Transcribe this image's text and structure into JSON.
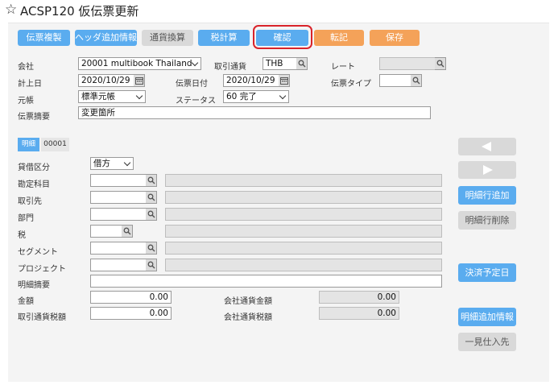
{
  "window": {
    "title": "ACSP120 仮伝票更新"
  },
  "toolbar": {
    "buttons": [
      "伝票複製",
      "ヘッダ追加情報",
      "通貨換算",
      "税計算",
      "確認",
      "転記",
      "保存"
    ]
  },
  "header": {
    "company_label": "会社",
    "company_value": "20001 multibook Thailand",
    "currency_label": "取引通貨",
    "currency_value": "THB",
    "rate_label": "レート",
    "rate_value": "",
    "posting_date_label": "計上日",
    "posting_date_value": "2020/10/29",
    "voucher_date_label": "伝票日付",
    "voucher_date_value": "2020/10/29",
    "voucher_type_label": "伝票タイプ",
    "voucher_type_value": "",
    "ledger_label": "元帳",
    "ledger_value": "標準元帳",
    "status_label": "ステータス",
    "status_value": "60 完了",
    "summary_label": "伝票摘要",
    "summary_value": "変更箇所"
  },
  "detail": {
    "tab_label": "明細",
    "line_number": "00001",
    "dc_label": "貸借区分",
    "dc_value": "借方",
    "account_label": "勘定科目",
    "partner_label": "取引先",
    "department_label": "部門",
    "tax_label": "税",
    "segment_label": "セグメント",
    "project_label": "プロジェクト",
    "line_summary_label": "明細摘要",
    "amount_label": "金額",
    "amount_value": "0.00",
    "tax_amount_label": "取引通貨税額",
    "tax_amount_value": "0.00",
    "company_amount_label": "会社通貨金額",
    "company_amount_value": "0.00",
    "company_tax_label": "会社通貨税額",
    "company_tax_value": "0.00"
  },
  "side_buttons": {
    "add_line": "明細行追加",
    "delete_line": "明細行削除",
    "due_date": "決済予定日",
    "line_info": "明細追加情報",
    "one_time_supplier": "一見仕入先"
  },
  "colors": {
    "accent": "#5aacef",
    "orange": "#f4a259",
    "highlight": "#d9232a",
    "panel": "#f4f4f4"
  }
}
